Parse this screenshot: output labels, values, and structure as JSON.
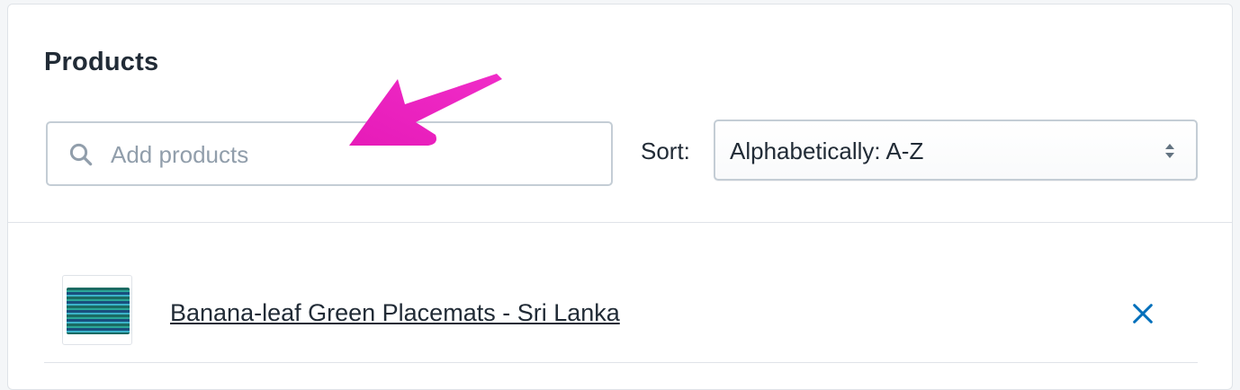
{
  "card": {
    "title": "Products"
  },
  "search": {
    "placeholder": "Add products",
    "value": "",
    "icon": "search-icon"
  },
  "sort": {
    "label": "Sort:",
    "selected": "Alphabetically: A-Z",
    "icon": "select-caret-icon"
  },
  "products": [
    {
      "name": "Banana-leaf Green Placemats - Sri Lanka",
      "thumbnail": "placemat-thumbnail",
      "remove_icon": "close-icon"
    }
  ],
  "colors": {
    "text": "#212b36",
    "placeholder": "#919eab",
    "border": "#c4cdd5",
    "remove_icon": "#006fbb",
    "annotation_arrow": "#ec1ec2"
  }
}
